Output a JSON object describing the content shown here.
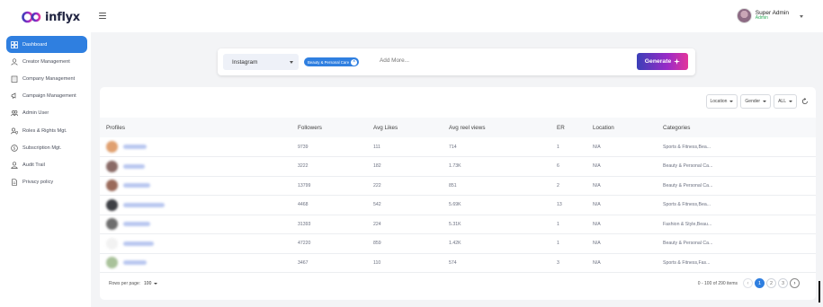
{
  "brand": {
    "name": "inflyx",
    "accent": "#2f7fe0"
  },
  "sidebar": {
    "items": [
      {
        "label": "Dashboard",
        "icon": "dashboard-icon",
        "active": true
      },
      {
        "label": "Creator Management",
        "icon": "user-icon"
      },
      {
        "label": "Company Management",
        "icon": "building-icon"
      },
      {
        "label": "Campaign Management",
        "icon": "megaphone-icon"
      },
      {
        "label": "Admin User",
        "icon": "users-icon"
      },
      {
        "label": "Roles & Rights Mgt.",
        "icon": "user-shield-icon"
      },
      {
        "label": "Subscription Mgt.",
        "icon": "dollar-circle-icon"
      },
      {
        "label": "Audit Trail",
        "icon": "user-check-icon"
      },
      {
        "label": "Privacy policy",
        "icon": "document-icon"
      }
    ]
  },
  "header": {
    "user_name": "Super Admin",
    "user_role": "Admin"
  },
  "search": {
    "platform": "Instagram",
    "chip": "Beauty & Personal Care",
    "placeholder": "Add More...",
    "generate_label": "Generate"
  },
  "filters": {
    "location": "Location",
    "gender": "Gender",
    "all": "ALL"
  },
  "table": {
    "columns": [
      "Profiles",
      "Followers",
      "Avg Likes",
      "Avg reel views",
      "ER",
      "Location",
      "Categories"
    ],
    "rows": [
      {
        "followers": "9739",
        "avg_likes": "111",
        "avg_reel_views": "714",
        "er": "1",
        "location": "N/A",
        "categories": "Sports & Fitness,Bea...",
        "pic_color": "#e0a070"
      },
      {
        "followers": "3222",
        "avg_likes": "182",
        "avg_reel_views": "1.73K",
        "er": "6",
        "location": "N/A",
        "categories": "Beauty & Personal Ca...",
        "pic_color": "#8a6a66"
      },
      {
        "followers": "13799",
        "avg_likes": "222",
        "avg_reel_views": "851",
        "er": "2",
        "location": "N/A",
        "categories": "Beauty & Personal Ca...",
        "pic_color": "#9a6a5a"
      },
      {
        "followers": "4468",
        "avg_likes": "542",
        "avg_reel_views": "5.69K",
        "er": "13",
        "location": "N/A",
        "categories": "Sports & Fitness,Bea...",
        "pic_color": "#3d3f44"
      },
      {
        "followers": "31393",
        "avg_likes": "224",
        "avg_reel_views": "5.31K",
        "er": "1",
        "location": "N/A",
        "categories": "Fashion & Style,Beau...",
        "pic_color": "#6e6e6e"
      },
      {
        "followers": "47220",
        "avg_likes": "859",
        "avg_reel_views": "1.42K",
        "er": "1",
        "location": "N/A",
        "categories": "Beauty & Personal Ca...",
        "pic_color": "#f2f2f2"
      },
      {
        "followers": "3467",
        "avg_likes": "110",
        "avg_reel_views": "574",
        "er": "3",
        "location": "N/A",
        "categories": "Sports & Fitness,Fas...",
        "pic_color": "#a9c29a"
      }
    ]
  },
  "pagination": {
    "rows_per_page_label": "Rows per page:",
    "rows_per_page": "100",
    "range": "0 - 100",
    "of": "of",
    "total": "290",
    "items_label": "items",
    "pages": [
      "1",
      "2",
      "3"
    ],
    "prev": "‹",
    "next": "›"
  }
}
